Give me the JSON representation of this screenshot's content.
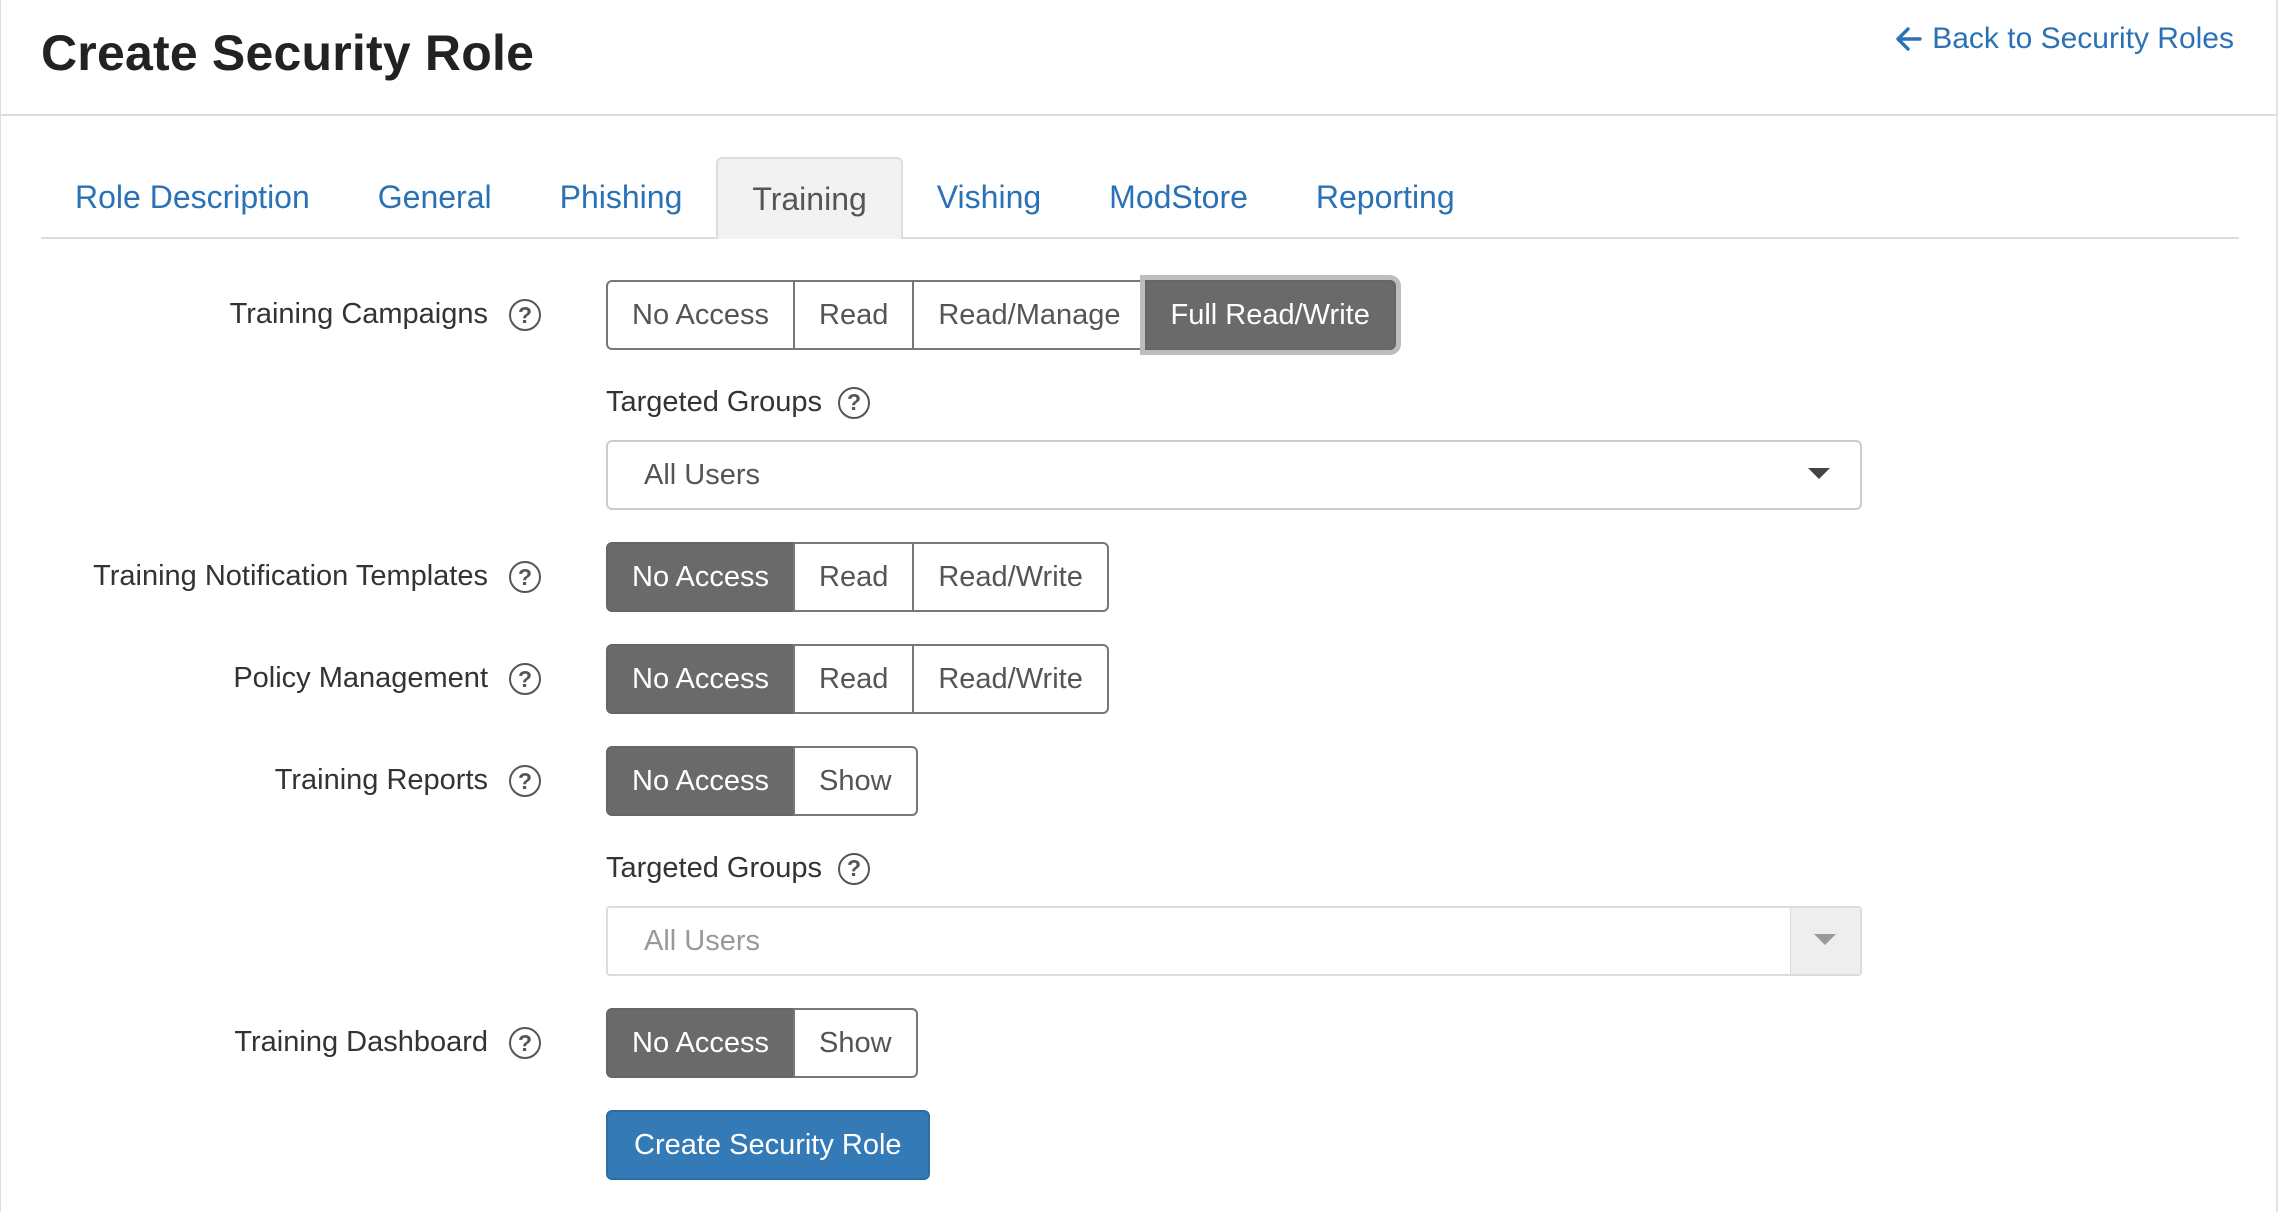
{
  "header": {
    "title": "Create Security Role",
    "back_link": "Back to Security Roles"
  },
  "tabs": [
    {
      "label": "Role Description"
    },
    {
      "label": "General"
    },
    {
      "label": "Phishing"
    },
    {
      "label": "Training",
      "active": true
    },
    {
      "label": "Vishing"
    },
    {
      "label": "ModStore"
    },
    {
      "label": "Reporting"
    }
  ],
  "help_glyph": "?",
  "permissions": {
    "training_campaigns": {
      "label": "Training Campaigns",
      "options": [
        "No Access",
        "Read",
        "Read/Manage",
        "Full Read/Write"
      ],
      "selected": "Full Read/Write",
      "targeted_groups": {
        "label": "Targeted Groups",
        "value": "All Users",
        "disabled": false
      }
    },
    "training_notification_templates": {
      "label": "Training Notification Templates",
      "options": [
        "No Access",
        "Read",
        "Read/Write"
      ],
      "selected": "No Access"
    },
    "policy_management": {
      "label": "Policy Management",
      "options": [
        "No Access",
        "Read",
        "Read/Write"
      ],
      "selected": "No Access"
    },
    "training_reports": {
      "label": "Training Reports",
      "options": [
        "No Access",
        "Show"
      ],
      "selected": "No Access",
      "targeted_groups": {
        "label": "Targeted Groups",
        "value": "All Users",
        "disabled": true
      }
    },
    "training_dashboard": {
      "label": "Training Dashboard",
      "options": [
        "No Access",
        "Show"
      ],
      "selected": "No Access"
    }
  },
  "submit_label": "Create Security Role",
  "colors": {
    "link": "#2a72b5",
    "active_toggle": "#6a6a6a",
    "primary_button": "#337ab7"
  }
}
